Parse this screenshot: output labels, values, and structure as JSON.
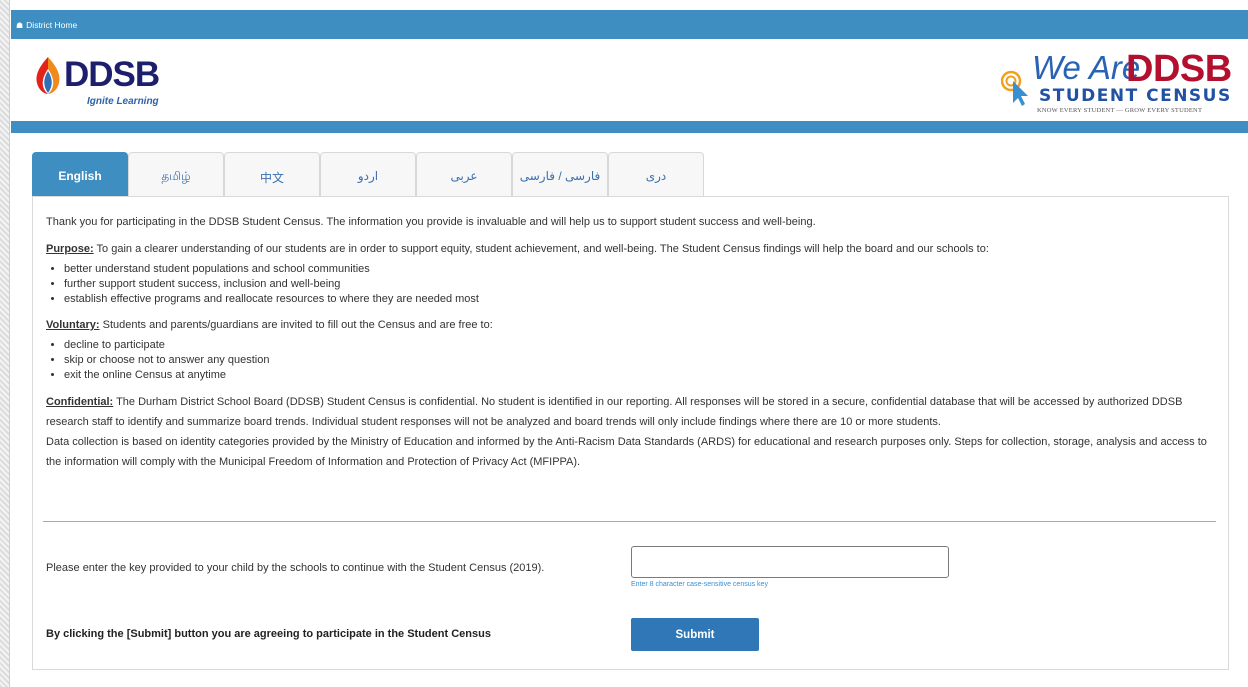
{
  "topbar": {
    "home_label": "District Home",
    "home_icon": "home-icon"
  },
  "logo": {
    "name": "DDSB",
    "tagline": "Ignite Learning"
  },
  "census_logo": {
    "we_are": "We Are",
    "ddsb": "DDSB",
    "student_census": "STUDENT CENSUS",
    "slogan": "KNOW EVERY STUDENT — GROW EVERY STUDENT"
  },
  "tabs": [
    {
      "label": "English",
      "active": true
    },
    {
      "label": "தமிழ்"
    },
    {
      "label": "中文"
    },
    {
      "label": "اردو"
    },
    {
      "label": "عربی"
    },
    {
      "label": "فارسی / فارسی"
    },
    {
      "label": "دری"
    }
  ],
  "content": {
    "intro": "Thank you for participating in the DDSB Student Census. The information you provide is invaluable and will help us to support student success and well-being.",
    "purpose_label": "Purpose:",
    "purpose_text": " To gain a clearer understanding of our students are in order to support equity, student achievement, and well-being. The Student Census findings will help the board and our schools to:",
    "purpose_items": [
      "better understand student populations and school communities",
      "further support student success, inclusion and well-being",
      "establish effective programs and reallocate resources to where they are needed most"
    ],
    "voluntary_label": "Voluntary:",
    "voluntary_text": " Students and parents/guardians are invited to fill out the Census and are free to:",
    "voluntary_items": [
      "decline to participate",
      "skip or choose not to answer any question",
      "exit the online Census at anytime"
    ],
    "confidential_label": "Confidential:",
    "confidential_text": " The Durham District School Board (DDSB) Student Census is confidential. No student is identified in our reporting. All responses will be stored in a secure, confidential database that will be accessed by authorized DDSB research staff to identify and summarize board trends. Individual student responses will not be analyzed and board trends will only include findings where there are 10 or more students.",
    "data_collection": "Data collection is based on identity categories provided by the Ministry of Education and informed by the Anti-Racism Data Standards (ARDS) for educational and research purposes only. Steps for collection, storage, analysis and access to the information will comply with the Municipal Freedom of Information and Protection of Privacy Act (MFIPPA)."
  },
  "form": {
    "key_label": "Please enter the key provided to your child by the schools to continue with the Student Census (2019).",
    "key_value": "",
    "key_hint": "Enter 8 character case-sensitive census key",
    "agree_text": "By clicking the [Submit] button you are agreeing to participate in the Student Census",
    "submit_label": "Submit"
  },
  "colors": {
    "primary": "#3e8ec1",
    "button": "#2f77b6",
    "logo_red": "#b30f2e",
    "logo_navy": "#1d1f6d"
  }
}
